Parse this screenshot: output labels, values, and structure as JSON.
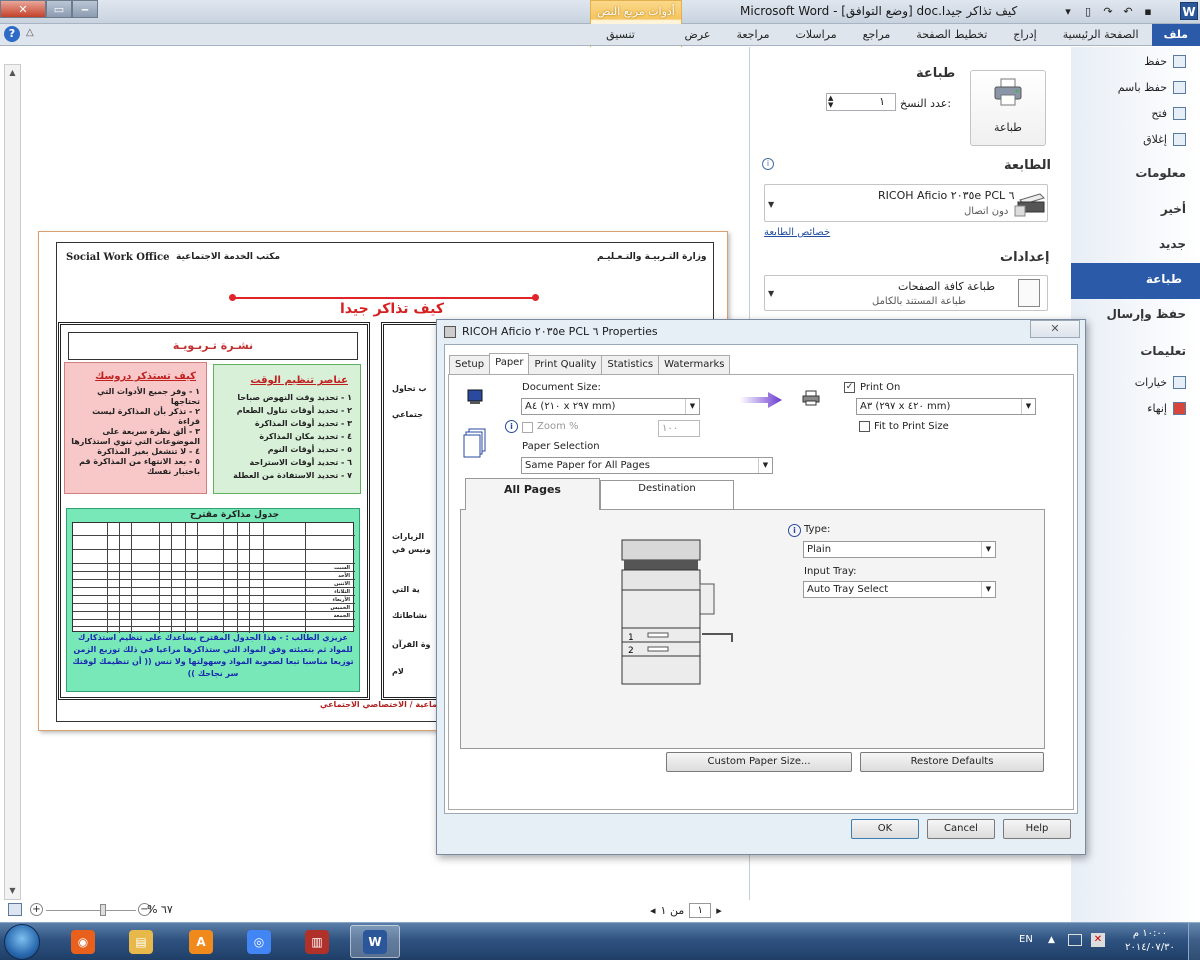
{
  "titlebar": {
    "doc_title": "كيف تذاكر جيدا.doc [وضع التوافق] - Microsoft Word",
    "contextual_group": "أدوات مربع النص"
  },
  "ribbon": {
    "tabs": [
      "ملف",
      "الصفحة الرئيسية",
      "إدراج",
      "تخطيط الصفحة",
      "مراجع",
      "مراسلات",
      "مراجعة",
      "عرض",
      "تنسيق"
    ]
  },
  "backstage": {
    "items": [
      {
        "label": "حفظ",
        "type": "cmd"
      },
      {
        "label": "حفظ باسم",
        "type": "cmd"
      },
      {
        "label": "فتح",
        "type": "cmd"
      },
      {
        "label": "إغلاق",
        "type": "cmd"
      },
      {
        "label": "معلومات",
        "type": "big"
      },
      {
        "label": "أخير",
        "type": "big"
      },
      {
        "label": "جديد",
        "type": "big"
      },
      {
        "label": "طباعة",
        "type": "selected"
      },
      {
        "label": "حفظ وإرسال",
        "type": "big"
      },
      {
        "label": "تعليمات",
        "type": "big"
      },
      {
        "label": "خيارات",
        "type": "cmd"
      },
      {
        "label": "إنهاء",
        "type": "cmd"
      }
    ]
  },
  "print_panel": {
    "heading": "طباعة",
    "copies_label": "عدد النسخ:",
    "copies_value": "١",
    "print_button": "طباعة",
    "printer_heading": "الطابعة",
    "printer_name": "RICOH Aficio ٢٠٣٥e PCL ٦",
    "printer_status": "دون اتصال",
    "printer_properties": "خصائص الطابعة",
    "settings_heading": "إعدادات",
    "pages_title": "طباعة كافة الصفحات",
    "pages_sub": "طباعة المستند بالكامل"
  },
  "document": {
    "header_left": "Social Work Office",
    "header_mid": "مكتب الخدمة الاجتماعية",
    "header_right": "وزارة التـربيـة والتـعـليـم",
    "title": "كيف تذاكر جيدا",
    "newsletter": "نشـرة تـربـويـة",
    "pink_title": "كيف تستذكر دروسك",
    "pink_items": [
      "١ - وفر جميع الأدوات التي تحتاجها",
      "٢ - تذكر بأن المذاكرة ليست قراءة",
      "٣ - ألق نظرة سريعة على",
      "الموضوعات التي تنوي استذكارها",
      "٤ - لا تنشغل بغير المذاكرة",
      "٥ - بعد الانتهاء من المذاكرة قم",
      "باختبار نفسك"
    ],
    "green_title": "عناصر تنظيم الوقت",
    "green_items": [
      "١ - تحديد وقت النهوض صباحا",
      "٢ - تحديد أوقات تناول الطعام",
      "٣ - تحديد أوقات المذاكرة",
      "٤ - تحديد مكان المذاكرة",
      "٥ - تحديد أوقات النوم",
      "٦ - تحديد أوقات الاستراحة",
      "٧ - تحديد الاستفادة من العطلة"
    ],
    "table_title": "جدول مذاكرة مقترح",
    "table_days": [
      "السبت",
      "الأحد",
      "الاثنين",
      "الثلاثاء",
      "الأربعاء",
      "الخميس",
      "الجمعة"
    ],
    "table_note": "عزيزي الطالب : - هذا الجدول المقترح يساعدك على تنظيم استذكارك للمواد ثم بتعبئته وفق المواد التي ستذاكرها مراعيا في ذلك توزيع الزمن توزيعا مناسبا تبعا لصعوبة المواد وسهولتها ولا تنس (( أن تنظيمك لوقتك سر نجاحك ))",
    "footer": "ماعية / الاختصاصي الاجتماعي",
    "right_fragments": [
      "ب تحاول",
      "جتماعي",
      "الزيارات",
      "ونيس في",
      "ية التي",
      "نشاطاتك",
      "وة القرآن",
      "لام"
    ]
  },
  "statusbar": {
    "zoom_percent": "٦٧ %",
    "page_current": "١",
    "page_of": "من ١"
  },
  "dialog": {
    "title": "RICOH Aficio ٢٠٣٥e PCL ٦ Properties",
    "close": "✕",
    "tabs": [
      "Setup",
      "Paper",
      "Print Quality",
      "Statistics",
      "Watermarks"
    ],
    "active_tab": "Paper",
    "document_size_label": "Document Size:",
    "document_size_value": "A٤ (٢١٠ x ٢٩٧ mm)",
    "zoom_label": "Zoom %",
    "zoom_value": "١٠٠",
    "paper_selection_label": "Paper Selection",
    "paper_selection_value": "Same Paper for All Pages",
    "print_on_label": "Print On",
    "print_on_value": "A٣ (٢٩٧ x ٤٢٠ mm)",
    "fit_to_print_label": "Fit to Print Size",
    "inner_tabs": [
      "All Pages",
      "Destination"
    ],
    "type_label": "Type:",
    "type_value": "Plain",
    "input_tray_label": "Input Tray:",
    "input_tray_value": "Auto Tray Select",
    "custom_paper_button": "Custom Paper Size...",
    "restore_button": "Restore Defaults",
    "ok_button": "OK",
    "cancel_button": "Cancel",
    "help_button": "Help",
    "print_on_checked": true,
    "fit_checked": false
  },
  "taskbar": {
    "lang": "EN",
    "clock_time": "١٠:٠٠ م",
    "clock_date": "٢٠١٤/٠٧/٣٠",
    "apps": [
      "firefox-icon",
      "file-explorer-icon",
      "avast-icon",
      "chrome-icon",
      "winrar-icon",
      "word-icon"
    ]
  }
}
